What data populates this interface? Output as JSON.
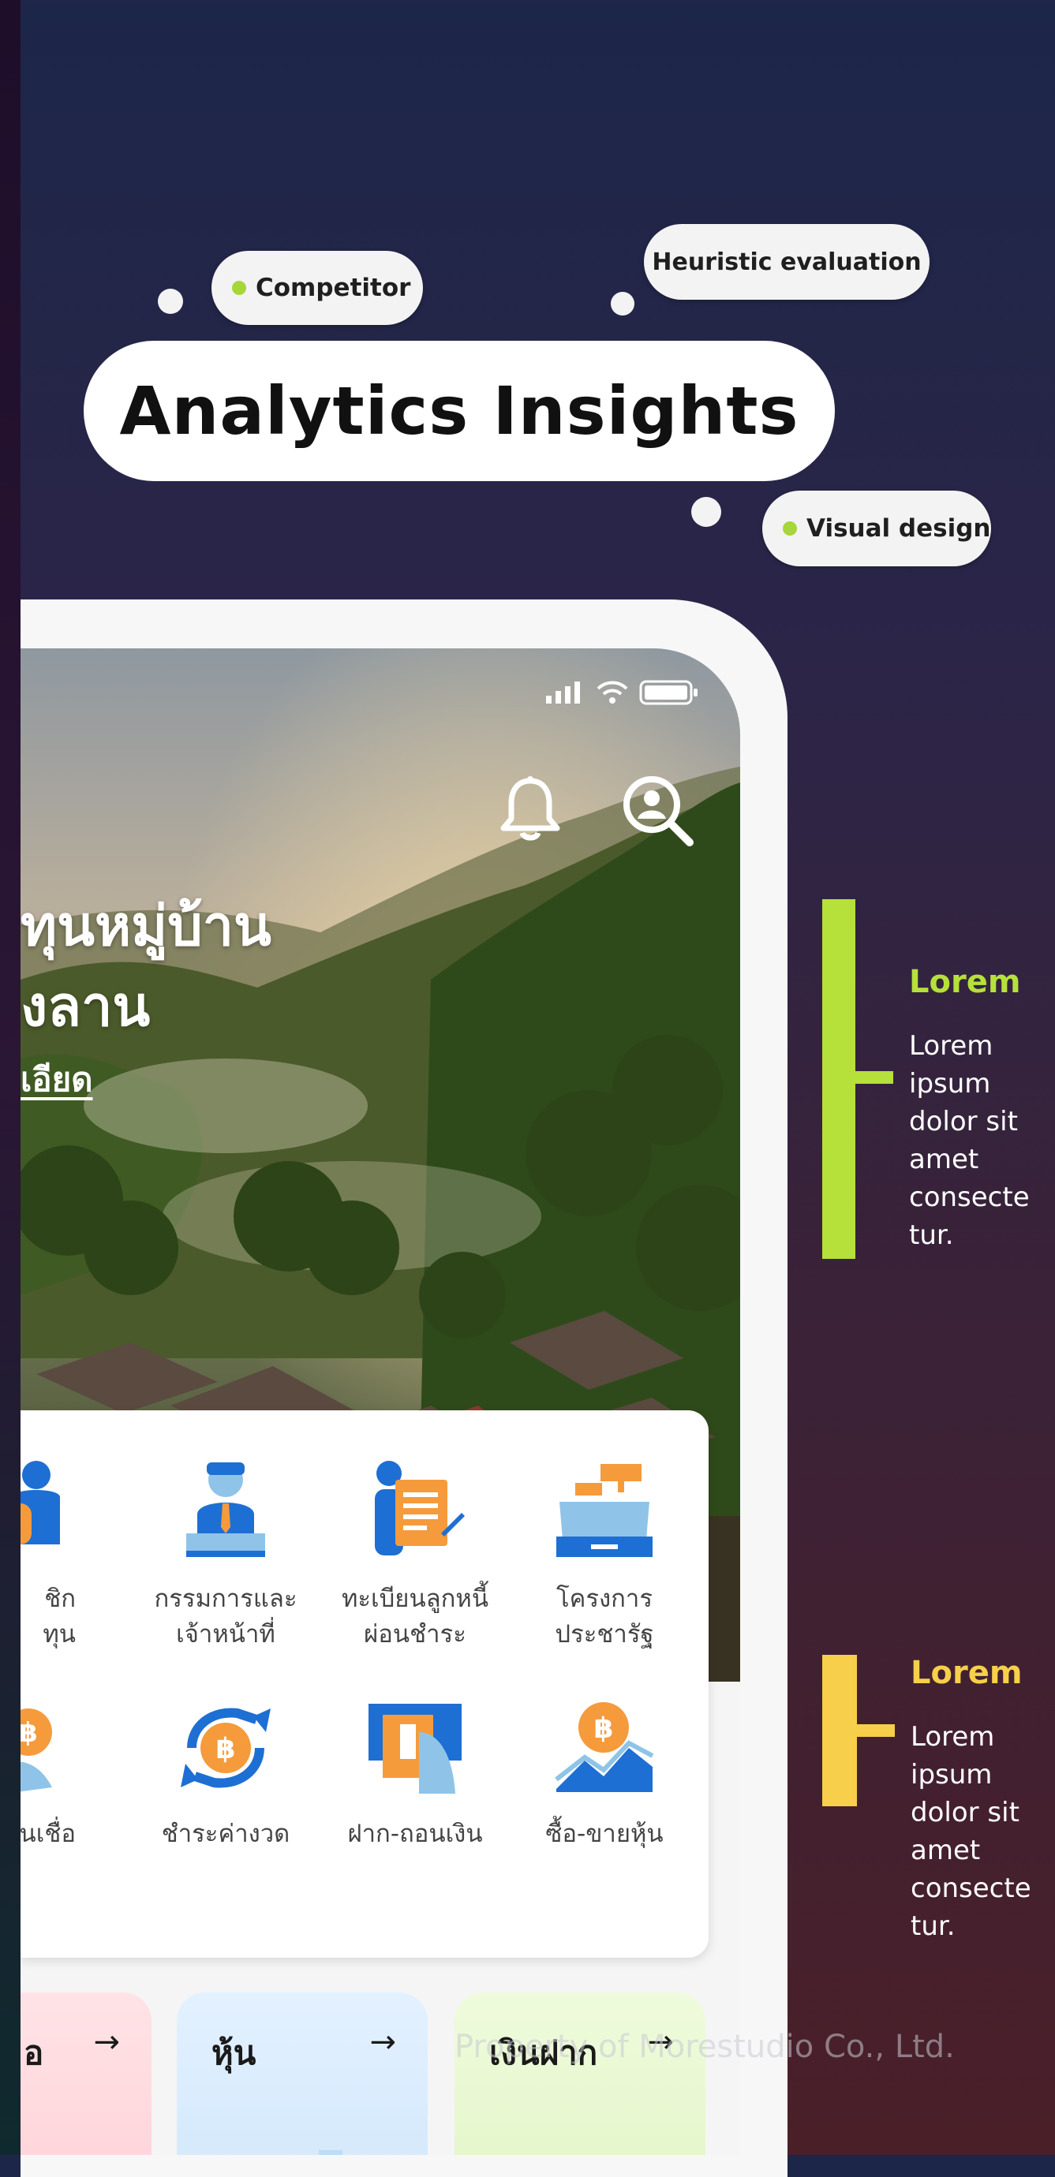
{
  "tags": {
    "competitor": "Competitor",
    "heuristic": "Heuristic evaluation",
    "visual": "Visual design",
    "title": "Analytics Insights"
  },
  "app": {
    "hero_line1": "ทุนหมู่บ้าน",
    "hero_line2": "งลาน",
    "hero_link": "เอียด",
    "services": [
      {
        "label1": "ชิก",
        "label2": "ทุน",
        "icon": "member-icon"
      },
      {
        "label1": "กรรมการและ",
        "label2": "เจ้าหน้าที่",
        "icon": "committee-icon"
      },
      {
        "label1": "ทะเบียนลูกหนี้",
        "label2": "ผ่อนชำระ",
        "icon": "debtor-register-icon"
      },
      {
        "label1": "โครงการ",
        "label2": "ประชารัฐ",
        "icon": "cash-register-icon"
      },
      {
        "label1": "นเชื่อ",
        "label2": "",
        "icon": "loan-icon"
      },
      {
        "label1": "ชำระค่างวด",
        "label2": "",
        "icon": "installment-icon"
      },
      {
        "label1": "ฝาก-ถอนเงิน",
        "label2": "",
        "icon": "deposit-withdraw-icon"
      },
      {
        "label1": "ซื้อ-ขายหุ้น",
        "label2": "",
        "icon": "stock-trade-icon"
      }
    ],
    "tiles": [
      {
        "title": "อ",
        "arrow": "→"
      },
      {
        "title": "หุ้น",
        "arrow": "→"
      },
      {
        "title": "เงินฝาก",
        "arrow": "→"
      }
    ]
  },
  "annotations": [
    {
      "title": "Lorem",
      "body": "Lorem ipsum dolor sit amet consecte tur.",
      "color": "#b6e03a"
    },
    {
      "title": "Lorem",
      "body": "Lorem ipsum dolor sit amet consecte tur.",
      "color": "#f7cf4a"
    }
  ],
  "watermark": "Property of Morestudio Co., Ltd."
}
